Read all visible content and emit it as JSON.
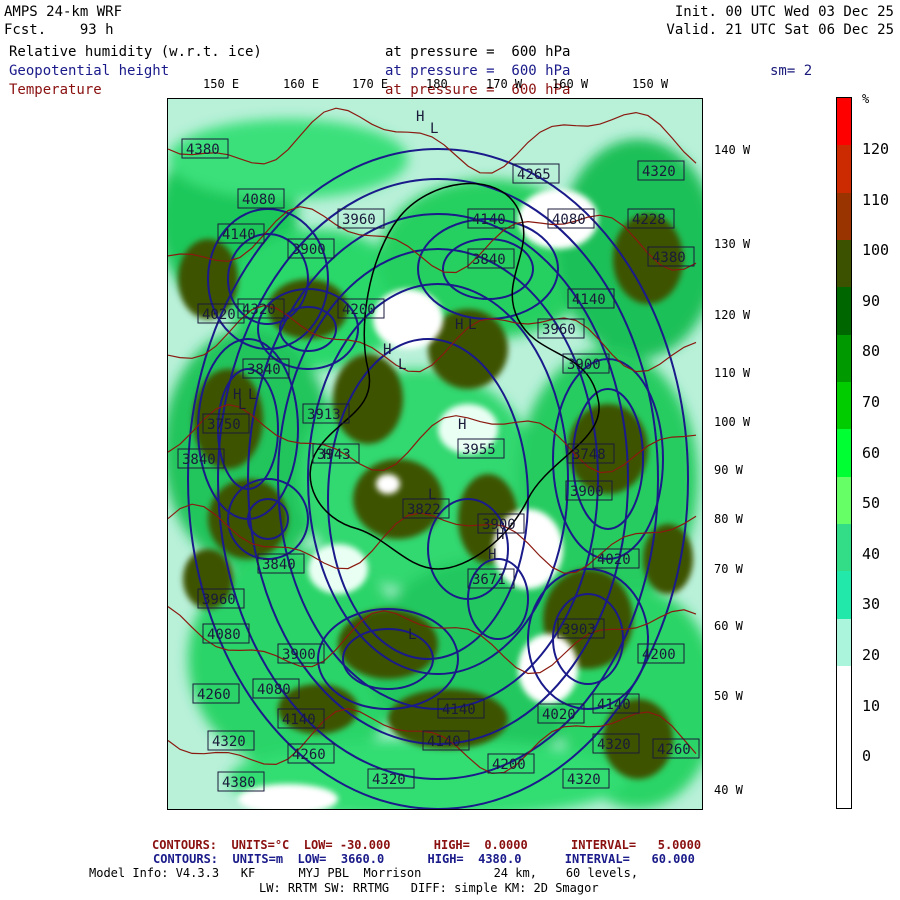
{
  "header": {
    "title": "AMPS 24-km WRF",
    "fcst_label": "Fcst.",
    "fcst_value": "93 h",
    "init": "Init. 00 UTC Wed 03 Dec 25",
    "valid": "Valid. 21 UTC Sat 06 Dec 25"
  },
  "variables": [
    {
      "name": "Relative humidity (w.r.t. ice)",
      "level": "at pressure =  600 hPa",
      "color": "#000000"
    },
    {
      "name": "Geopotential height",
      "level": "at pressure =  600 hPa",
      "color": "#1a1a8a"
    },
    {
      "name": "Temperature",
      "level": "at pressure =  600 hPa",
      "color": "#8a1010"
    }
  ],
  "smoothing": "sm= 2",
  "top_longitudes": [
    "150 E",
    "160 E",
    "170 E",
    "180",
    "170 W",
    "160 W",
    "150 W"
  ],
  "right_longitudes": [
    "140 W",
    "130 W",
    "120 W",
    "110 W",
    "100 W",
    "90 W",
    "80 W",
    "70 W",
    "60 W",
    "50 W",
    "40 W"
  ],
  "colorbar": {
    "unit": "%",
    "ticks": [
      "120",
      "110",
      "100",
      "90",
      "80",
      "70",
      "60",
      "50",
      "40",
      "30",
      "20",
      "10",
      "0"
    ],
    "colors": [
      "#ff0000",
      "#cc2a00",
      "#993300",
      "#3d5200",
      "#006600",
      "#009900",
      "#00cc00",
      "#00ff33",
      "#66ff66",
      "#33dd88",
      "#22e8aa",
      "#aaf5dc",
      "#ffffff",
      "#ffffff",
      "#ffffff"
    ]
  },
  "height_labels": [
    {
      "text": "4380"
    },
    {
      "text": "4320"
    },
    {
      "text": "4265"
    },
    {
      "text": "4320"
    },
    {
      "text": "4228"
    },
    {
      "text": "4140"
    },
    {
      "text": "4080"
    },
    {
      "text": "3900"
    },
    {
      "text": "4140"
    },
    {
      "text": "4080"
    },
    {
      "text": "4140"
    },
    {
      "text": "4020"
    },
    {
      "text": "3960"
    },
    {
      "text": "3900"
    },
    {
      "text": "3840"
    },
    {
      "text": "3913"
    },
    {
      "text": "3750"
    },
    {
      "text": "3955"
    },
    {
      "text": "3748"
    },
    {
      "text": "3840"
    },
    {
      "text": "3943"
    },
    {
      "text": "3822"
    },
    {
      "text": "3900"
    },
    {
      "text": "3900"
    },
    {
      "text": "3840"
    },
    {
      "text": "3671"
    },
    {
      "text": "4020"
    },
    {
      "text": "3960"
    },
    {
      "text": "3903"
    },
    {
      "text": "4080"
    },
    {
      "text": "3900"
    },
    {
      "text": "4200"
    },
    {
      "text": "4260"
    },
    {
      "text": "4080"
    },
    {
      "text": "4140"
    },
    {
      "text": "4020"
    },
    {
      "text": "4140"
    },
    {
      "text": "4140"
    },
    {
      "text": "4320"
    },
    {
      "text": "4260"
    },
    {
      "text": "4200"
    },
    {
      "text": "4320"
    },
    {
      "text": "4260"
    },
    {
      "text": "4380"
    },
    {
      "text": "4380"
    },
    {
      "text": "4320"
    },
    {
      "text": "4140"
    },
    {
      "text": "3960"
    },
    {
      "text": "3840"
    },
    {
      "text": "4200"
    },
    {
      "text": "4320"
    }
  ],
  "hl_markers": [
    "H",
    "L",
    "H",
    "L",
    "H",
    "L",
    "H",
    "H",
    "L",
    "L",
    "H",
    "L",
    "H",
    "L",
    "H"
  ],
  "footer": {
    "temp_contours": "CONTOURS:  UNITS=°C  LOW= -30.000      HIGH=  0.0000      INTERVAL=   5.0000",
    "height_contours": "CONTOURS:  UNITS=m  LOW=  3660.0      HIGH=  4380.0      INTERVAL=   60.000",
    "model_info": "Model Info: V4.3.3   KF      MYJ PBL  Morrison          24 km,    60 levels,",
    "physics": "LW: RRTM SW: RRTMG   DIFF: simple KM: 2D Smagor"
  }
}
